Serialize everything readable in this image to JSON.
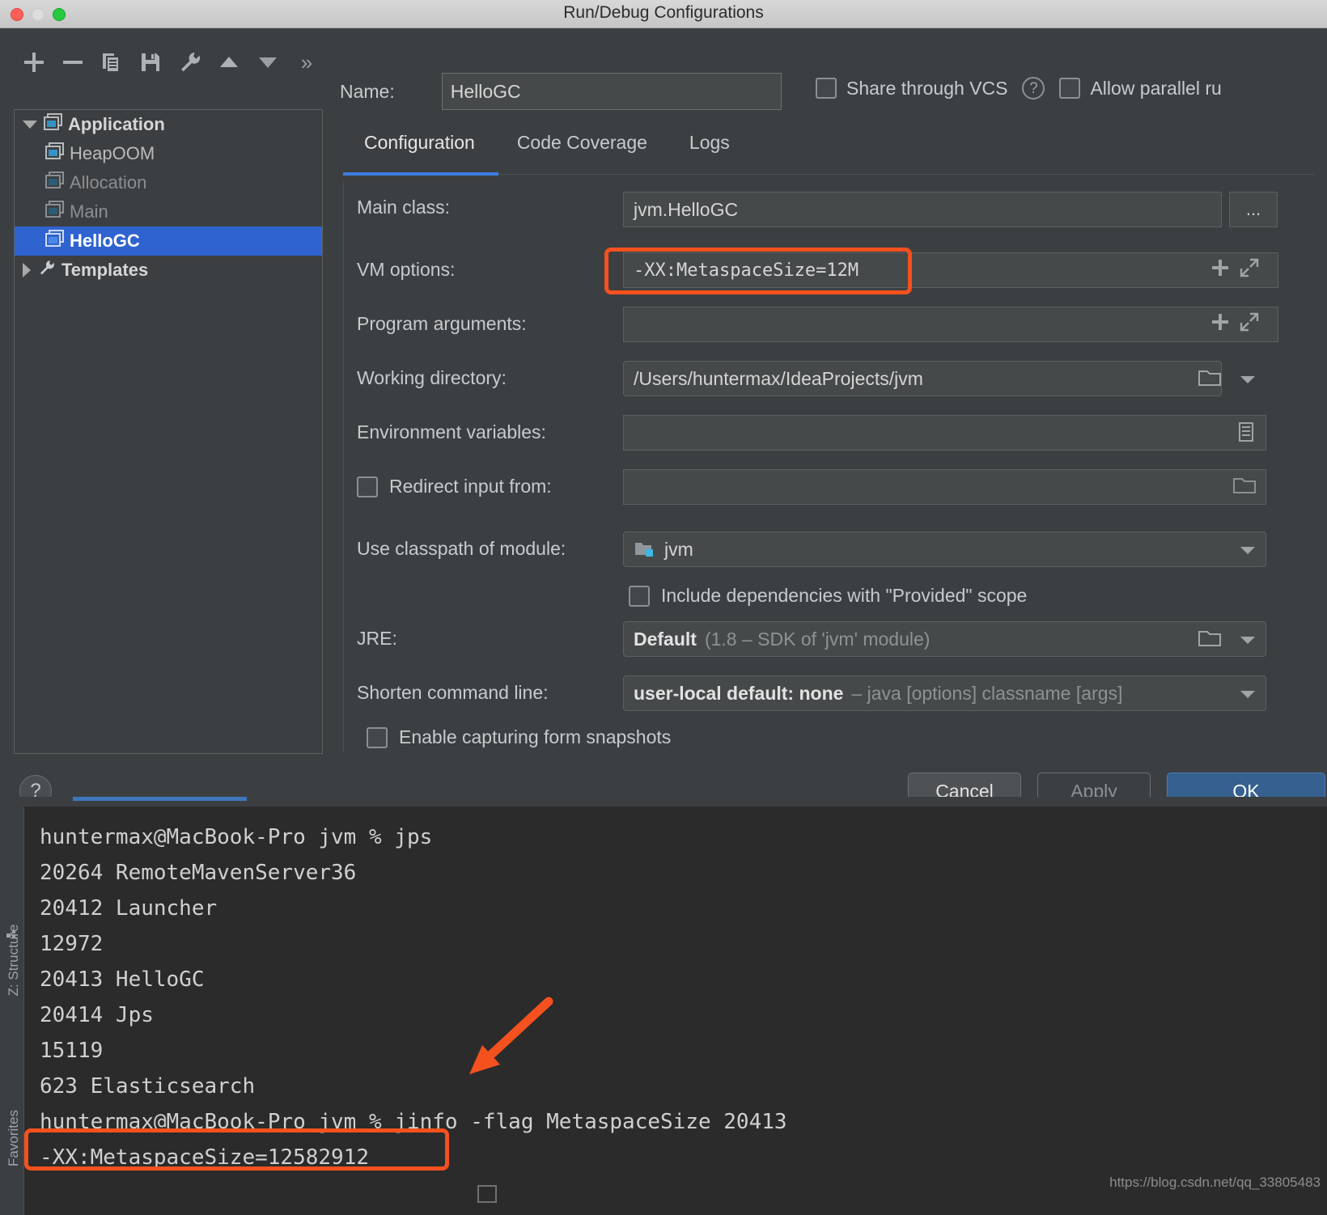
{
  "window": {
    "title": "Run/Debug Configurations",
    "traffic_lights": [
      "close-red",
      "minimize-yellow",
      "maximize-green"
    ]
  },
  "toolbar": {
    "buttons": [
      {
        "name": "add-configuration-button",
        "icon": "plus-icon",
        "glyph": "+"
      },
      {
        "name": "remove-configuration-button",
        "icon": "minus-icon",
        "glyph": "−"
      },
      {
        "name": "copy-configuration-button",
        "icon": "copy-icon",
        "glyph": "⧉"
      },
      {
        "name": "save-configuration-button",
        "icon": "save-icon",
        "glyph": "▤"
      },
      {
        "name": "edit-templates-button",
        "icon": "wrench-icon",
        "glyph": "🔧"
      },
      {
        "name": "move-up-button",
        "icon": "triangle-up-icon",
        "glyph": "▲"
      },
      {
        "name": "move-down-button",
        "icon": "triangle-down-icon",
        "glyph": "▼"
      },
      {
        "name": "more-options-button",
        "icon": "chevron-double-right-icon",
        "glyph": "»"
      }
    ]
  },
  "tree": {
    "items": [
      {
        "label": "Application",
        "level": 0,
        "state": "expanded",
        "icon": "application-icon",
        "selected": false,
        "dim": false
      },
      {
        "label": "HeapOOM",
        "level": 1,
        "state": "leaf",
        "icon": "run-config-icon",
        "selected": false,
        "dim": false
      },
      {
        "label": "Allocation",
        "level": 1,
        "state": "leaf",
        "icon": "run-config-icon",
        "selected": false,
        "dim": true
      },
      {
        "label": "Main",
        "level": 1,
        "state": "leaf",
        "icon": "run-config-icon",
        "selected": false,
        "dim": true
      },
      {
        "label": "HelloGC",
        "level": 1,
        "state": "leaf",
        "icon": "run-config-icon",
        "selected": true,
        "dim": false
      },
      {
        "label": "Templates",
        "level": 0,
        "state": "collapsed",
        "icon": "wrench-icon",
        "selected": false,
        "dim": false
      }
    ]
  },
  "header": {
    "name_label": "Name:",
    "name_value": "HelloGC",
    "share_vcs_label": "Share through VCS",
    "share_vcs_checked": false,
    "help_icon": "question-mark-icon",
    "allow_parallel_label": "Allow parallel ru",
    "allow_parallel_checked": false
  },
  "tabs": [
    {
      "label": "Configuration",
      "active": true
    },
    {
      "label": "Code Coverage",
      "active": false
    },
    {
      "label": "Logs",
      "active": false
    }
  ],
  "form": {
    "main_class": {
      "label": "Main class:",
      "value": "jvm.HelloGC",
      "browse": "..."
    },
    "vm_options": {
      "label": "VM options:",
      "value": "-XX:MetaspaceSize=12M",
      "highlighted": true,
      "expand_icon": "expand-icon",
      "insert_icon": "plus-icon"
    },
    "program_arguments": {
      "label": "Program arguments:",
      "value": "",
      "expand_icon": "expand-icon",
      "insert_icon": "plus-icon"
    },
    "working_directory": {
      "label": "Working directory:",
      "value": "/Users/huntermax/IdeaProjects/jvm",
      "browse_icon": "folder-icon",
      "dropdown_icon": "chevron-down-icon"
    },
    "environment_variables": {
      "label": "Environment variables:",
      "value": "",
      "browse_icon": "list-icon"
    },
    "redirect_input": {
      "label": "Redirect input from:",
      "checked": false,
      "value": "",
      "browse_icon": "folder-icon"
    },
    "use_classpath": {
      "label": "Use classpath of module:",
      "value": "jvm",
      "module_icon": "module-folder-icon",
      "dropdown_icon": "chevron-down-icon"
    },
    "include_dependencies": {
      "label": "Include dependencies with \"Provided\" scope",
      "checked": false
    },
    "jre": {
      "label": "JRE:",
      "value": "Default",
      "hint": "(1.8 – SDK of 'jvm' module)",
      "browse_icon": "folder-icon",
      "dropdown_icon": "chevron-down-icon"
    },
    "shorten_command_line": {
      "label": "Shorten command line:",
      "value": "user-local default: none",
      "hint": "– java [options] classname [args]",
      "dropdown_icon": "chevron-down-icon"
    },
    "enable_snapshots": {
      "label": "Enable capturing form snapshots",
      "checked": false
    }
  },
  "footer": {
    "help_label": "?",
    "cancel_label": "Cancel",
    "apply_label": "Apply",
    "apply_enabled": false,
    "ok_label": "OK"
  },
  "terminal": {
    "lines": [
      "huntermax@MacBook-Pro jvm % jps",
      "20264 RemoteMavenServer36",
      "20412 Launcher",
      "12972",
      "20413 HelloGC",
      "20414 Jps",
      "15119",
      "623 Elasticsearch",
      "huntermax@MacBook-Pro jvm % jinfo -flag MetaspaceSize 20413",
      "-XX:MetaspaceSize=12582912"
    ],
    "highlighted_line_index": 9,
    "watermark": "https://blog.csdn.net/qq_33805483",
    "side_strips": [
      {
        "label": "Z: Structure",
        "icon": "structure-icon"
      },
      {
        "label": "Favorites",
        "icon": "favorites-icon"
      }
    ],
    "annotation_arrow": "orange-arrow-pointing-down-left"
  },
  "colors": {
    "accent_blue": "#3c7ddf",
    "selection_blue": "#2f63d0",
    "highlight_orange": "#f4511e",
    "dialog_bg": "#3c3f41",
    "terminal_bg": "#2b2b2b"
  }
}
